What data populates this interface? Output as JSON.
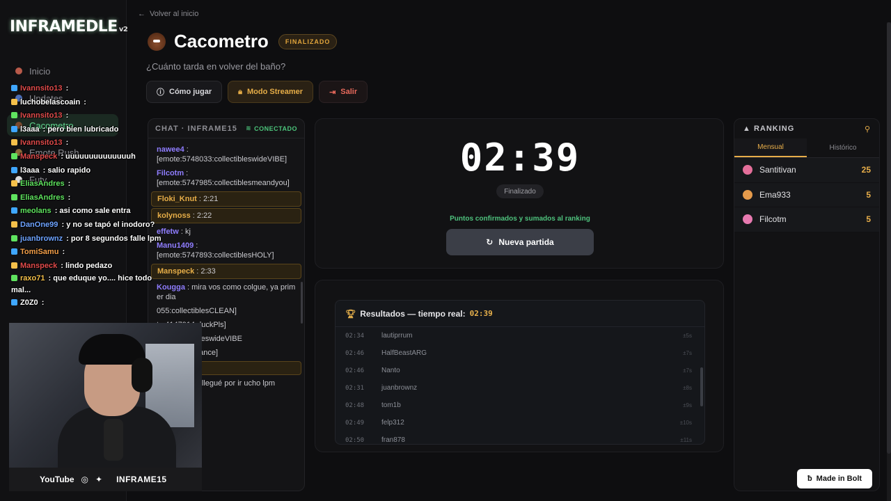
{
  "sidebar": {
    "logo": "INFRAMEDLE",
    "logo_version": "v2",
    "items": [
      {
        "label": "Inicio"
      },
      {
        "label": "Updates"
      },
      {
        "label": "Cacometro"
      },
      {
        "label": "Emote Rush"
      },
      {
        "label": "Futy"
      }
    ]
  },
  "overlay_chat": [
    {
      "user": "Ivannsito13",
      "sep": " :",
      "msg": "",
      "color": "#e14b4b"
    },
    {
      "user": "luchobelascoain",
      "sep": " :",
      "msg": "",
      "color": "#ffffff"
    },
    {
      "user": "Ivannsito13",
      "sep": " :",
      "msg": "",
      "color": "#e14b4b"
    },
    {
      "user": "l3aaa",
      "sep": " :",
      "msg": " pero bien lubricado",
      "color": "#ffffff"
    },
    {
      "user": "Ivannsito13",
      "sep": " :",
      "msg": "",
      "color": "#e14b4b"
    },
    {
      "user": "Manspeck",
      "sep": " :",
      "msg": " uuuuuuuuuuuuuuh",
      "color": "#e14b4b"
    },
    {
      "user": "l3aaa",
      "sep": " :",
      "msg": " salio rapido",
      "color": "#ffffff"
    },
    {
      "user": "EliasAndres",
      "sep": " :",
      "msg": "",
      "color": "#5fe35f"
    },
    {
      "user": "EliasAndres",
      "sep": " :",
      "msg": "",
      "color": "#5fe35f"
    },
    {
      "user": "meolans",
      "sep": " :",
      "msg": " asi como sale entra",
      "color": "#5fe35f"
    },
    {
      "user": "DanOne99",
      "sep": " :",
      "msg": " y no se tapó el inodoro?",
      "color": "#6ea3ff"
    },
    {
      "user": "juanbrownz",
      "sep": " :",
      "msg": " por 8 segundos falle lpm",
      "color": "#6ea3ff"
    },
    {
      "user": "TomiSamu",
      "sep": " :",
      "msg": "",
      "color": "#f5a04a"
    },
    {
      "user": "Manspeck",
      "sep": " :",
      "msg": " lindo pedazo",
      "color": "#e14b4b"
    },
    {
      "user": "raxo71",
      "sep": " :",
      "msg": " que eduque yo.... hice todo mal...",
      "color": "#f5c04a"
    },
    {
      "user": "Z0Z0",
      "sep": " :",
      "msg": "",
      "color": "#ffffff"
    }
  ],
  "streambar": {
    "youtube": "YouTube",
    "name": "INFRAME15"
  },
  "header": {
    "back": "Volver al inicio",
    "title": "Cacometro",
    "status": "FINALIZADO",
    "subtitle": "¿Cuánto tarda en volver del baño?",
    "buttons": {
      "how": "Cómo jugar",
      "streamer": "Modo Streamer",
      "exit": "Salir"
    }
  },
  "chat": {
    "title": "CHAT · INFRAME15",
    "status": "CONECTADO",
    "messages": [
      {
        "user": "nawee4",
        "text": " :\n [emote:5748033:collectibleswideVIBE]",
        "color": "#8f7dff",
        "hl": false
      },
      {
        "user": "Filcotm",
        "text": " :\n [emote:5747985:collectiblesmeandyou]",
        "color": "#8f7dff",
        "hl": false
      },
      {
        "user": "Floki_Knut",
        "text": " : 2:21",
        "color": "#e7ae48",
        "hl": true
      },
      {
        "user": "kolynoss",
        "text": " : 2:22",
        "color": "#e7ae48",
        "hl": true
      },
      {
        "user": "effetw",
        "text": " : kj",
        "color": "#8f7dff",
        "hl": false
      },
      {
        "user": "Manu1409",
        "text": " :\n [emote:5747893:collectiblesHOLY]",
        "color": "#8f7dff",
        "hl": false
      },
      {
        "user": "Manspeck",
        "text": " : 2:33",
        "color": "#e7ae48",
        "hl": true
      },
      {
        "user": "Kougga",
        "text": " : mira vos como colgue, ya primer dia",
        "color": "#8f7dff",
        "hl": false
      },
      {
        "user": "",
        "text": "055:collectiblesCLEAN]",
        "color": "#8f7dff",
        "hl": false
      },
      {
        "user": "",
        "text": "te:4147914:duckPls]",
        "color": "#8f7dff",
        "hl": false
      },
      {
        "user": "",
        "text": "033:collectibleswideVIBE",
        "color": "#8f7dff",
        "hl": false
      },
      {
        "user": "",
        "text": "616:DanceDance]",
        "color": "#8f7dff",
        "hl": false
      },
      {
        "user": "",
        "text": "",
        "color": "#e7ae48",
        "hl": true
      },
      {
        "user": "",
        "text": "ira que tarde llegué por ir ucho lpm",
        "color": "#8f7dff",
        "hl": false
      }
    ]
  },
  "timer": {
    "value": "02:39",
    "status": "Finalizado",
    "confirmed": "Puntos confirmados y sumados al ranking",
    "new_game": "Nueva partida"
  },
  "results": {
    "title": "Resultados — tiempo real:",
    "real_time": "02:39",
    "rows": [
      {
        "time": "02:34",
        "name": "lautiprrum",
        "diff": "±5s"
      },
      {
        "time": "02:46",
        "name": "HalfBeastARG",
        "diff": "±7s"
      },
      {
        "time": "02:46",
        "name": "Nanto",
        "diff": "±7s"
      },
      {
        "time": "02:31",
        "name": "juanbrownz",
        "diff": "±8s"
      },
      {
        "time": "02:48",
        "name": "tom1b",
        "diff": "±9s"
      },
      {
        "time": "02:49",
        "name": "felp312",
        "diff": "±10s"
      },
      {
        "time": "02:50",
        "name": "fran878",
        "diff": "±11s"
      }
    ]
  },
  "ranking": {
    "title": "RANKING",
    "tabs": [
      "Mensual",
      "Histórico"
    ],
    "rows": [
      {
        "name": "Santitivan",
        "points": "25",
        "color": "#e46f9a"
      },
      {
        "name": "Ema933",
        "points": "5",
        "color": "#e59a4b"
      },
      {
        "name": "Filcotm",
        "points": "5",
        "color": "#e77ab0"
      }
    ]
  },
  "bolt": "Made in Bolt"
}
